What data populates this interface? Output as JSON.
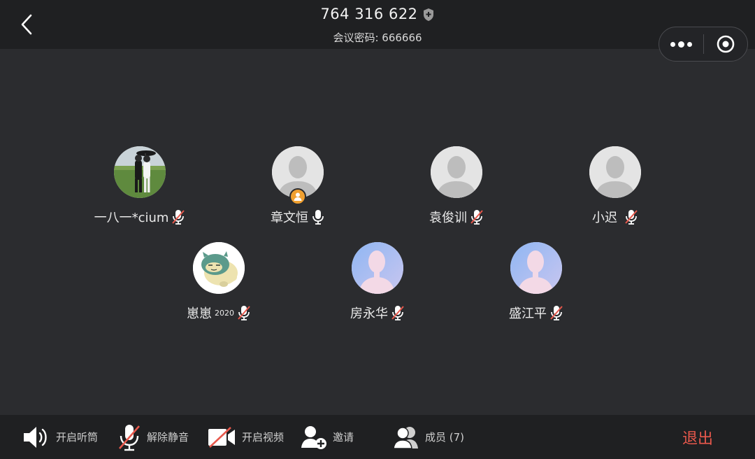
{
  "header": {
    "meeting_id": "764 316 622",
    "password_label": "会议密码: 666666"
  },
  "participants": [
    {
      "name": "一八一*cium",
      "mic": "muted",
      "avatar": "photo"
    },
    {
      "name": "章文恒",
      "mic": "on",
      "avatar": "default",
      "host": true
    },
    {
      "name": "袁俊训",
      "mic": "muted",
      "avatar": "default"
    },
    {
      "name": "小迟",
      "mic": "muted",
      "avatar": "default"
    },
    {
      "name": "崽崽",
      "name_sup": "2020",
      "mic": "muted",
      "avatar": "snorlax"
    },
    {
      "name": "房永华",
      "mic": "muted",
      "avatar": "blue-silhouette"
    },
    {
      "name": "盛江平",
      "mic": "muted",
      "avatar": "blue-silhouette"
    }
  ],
  "toolbar": {
    "speaker_label": "开启听筒",
    "unmute_label": "解除静音",
    "video_label": "开启视频",
    "invite_label": "邀请",
    "members_label": "成员 (7)",
    "exit_label": "退出"
  },
  "colors": {
    "background": "#2b2c2f",
    "bar": "#1f2022",
    "exit": "#e8584c",
    "muted_slash": "#e8584c",
    "host_badge": "#f0a030"
  }
}
